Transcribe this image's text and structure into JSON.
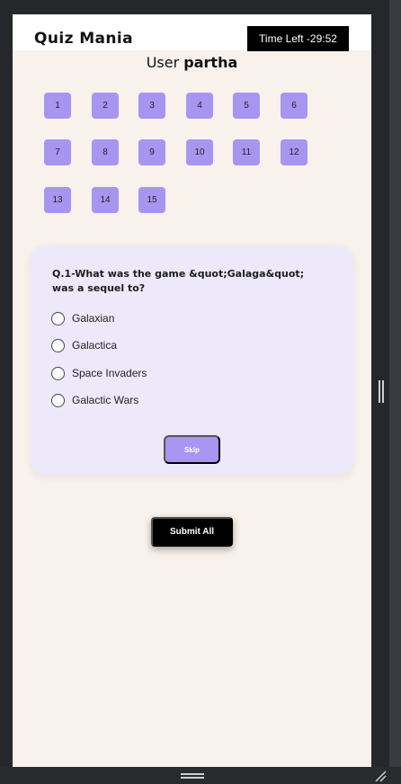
{
  "app": {
    "logo": "Quiz Mania",
    "timer_text": "Time Left -29:52",
    "user_prefix": "User",
    "user_name": "partha"
  },
  "question_nav": [
    "1",
    "2",
    "3",
    "4",
    "5",
    "6",
    "7",
    "8",
    "9",
    "10",
    "11",
    "12",
    "13",
    "14",
    "15"
  ],
  "question": {
    "text": "Q.1-What was the game &quot;Galaga&quot; was a sequel to?",
    "options": [
      "Galaxian",
      "Galactica",
      "Space Invaders",
      "Galactic Wars"
    ],
    "skip_label": "Skip"
  },
  "submit_label": "Submit All",
  "colors": {
    "accent": "#a696f0",
    "page_bg": "#f8f1ec",
    "card_bg": "#ede9fb",
    "dark": "#000000"
  }
}
